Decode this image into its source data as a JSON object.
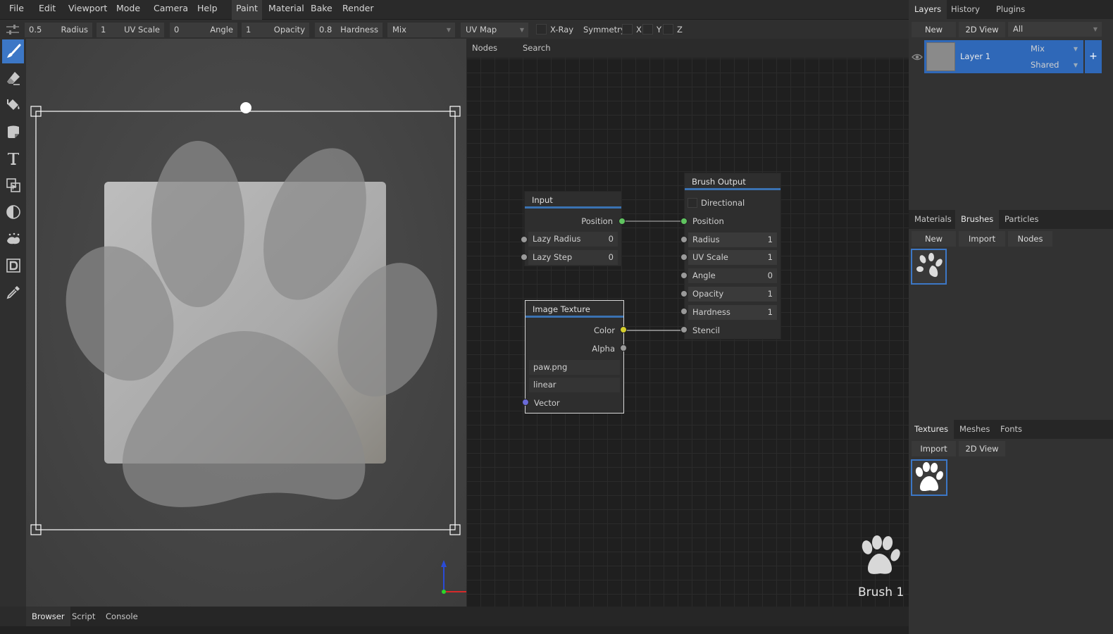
{
  "menu": {
    "items": [
      "File",
      "Edit",
      "Viewport",
      "Mode",
      "Camera",
      "Help"
    ],
    "workspaces": [
      "Paint",
      "Material",
      "Bake",
      "Render"
    ],
    "active_workspace": "Paint"
  },
  "toolbar": {
    "radius_value": "0.5",
    "radius_label": "Radius",
    "uvscale_value": "1",
    "uvscale_label": "UV Scale",
    "angle_value": "0",
    "angle_label": "Angle",
    "opacity_value": "1",
    "opacity_label": "Opacity",
    "hardness_value": "0.8",
    "hardness_label": "Hardness",
    "blend_mode": "Mix",
    "tex_coord": "UV Map",
    "xray_label": "X-Ray",
    "symmetry_label": "Symmetry",
    "sym_x": "X",
    "sym_y": "Y",
    "sym_z": "Z"
  },
  "tools": [
    "brush-icon",
    "eraser-icon",
    "fill-icon",
    "decal-icon",
    "text-icon",
    "clone-icon",
    "blur-icon",
    "particle-icon",
    "bake-icon",
    "picker-icon"
  ],
  "node_editor": {
    "tabs": [
      "Nodes",
      "Search"
    ],
    "input_node": {
      "title": "Input",
      "position": "Position",
      "lazy_radius": "Lazy Radius",
      "lazy_radius_val": "0",
      "lazy_step": "Lazy Step",
      "lazy_step_val": "0"
    },
    "image_node": {
      "title": "Image Texture",
      "color": "Color",
      "alpha": "Alpha",
      "file": "paw.png",
      "interp": "linear",
      "vector": "Vector"
    },
    "output_node": {
      "title": "Brush Output",
      "directional": "Directional",
      "position": "Position",
      "radius": "Radius",
      "radius_val": "1",
      "uvscale": "UV Scale",
      "uvscale_val": "1",
      "angle": "Angle",
      "angle_val": "0",
      "opacity": "Opacity",
      "opacity_val": "1",
      "hardness": "Hardness",
      "hardness_val": "1",
      "stencil": "Stencil"
    },
    "brush_preview_label": "Brush 1"
  },
  "layers_panel": {
    "tabs": [
      "Layers",
      "History",
      "Plugins"
    ],
    "new_btn": "New",
    "view_btn": "2D View",
    "filter": "All",
    "layer_name": "Layer 1",
    "layer_blend": "Mix",
    "layer_mode": "Shared",
    "add_glyph": "+"
  },
  "brushes_panel": {
    "tabs": [
      "Materials",
      "Brushes",
      "Particles"
    ],
    "new_btn": "New",
    "import_btn": "Import",
    "nodes_btn": "Nodes"
  },
  "textures_panel": {
    "tabs": [
      "Textures",
      "Meshes",
      "Fonts"
    ],
    "import_btn": "Import",
    "view_btn": "2D View"
  },
  "bottom_tabs": [
    "Browser",
    "Script",
    "Console"
  ],
  "colors": {
    "accent": "#3c77c6",
    "socket_green": "#5fc45f",
    "socket_yellow": "#d6cf2c",
    "socket_blue": "#6a6ad8"
  }
}
